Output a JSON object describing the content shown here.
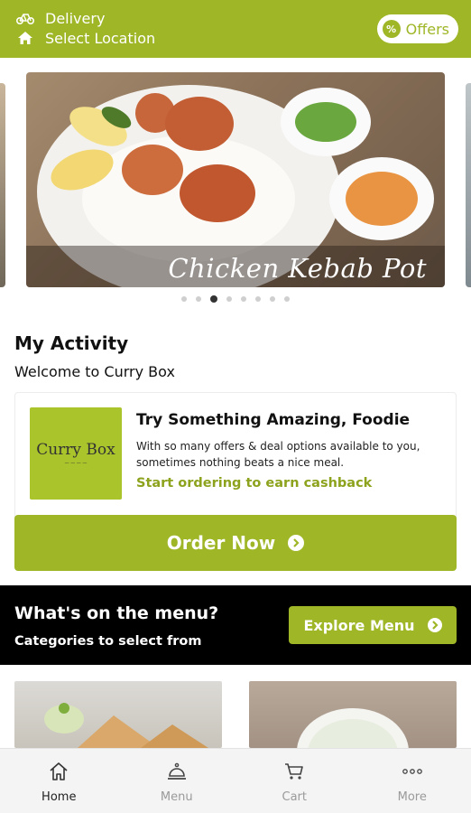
{
  "header": {
    "delivery_label": "Delivery",
    "location_label": "Select Location",
    "offers_label": "Offers"
  },
  "carousel": {
    "caption": "Chicken Kebab Pot",
    "slide_count": 8,
    "active_index": 2
  },
  "activity": {
    "title": "My Activity",
    "subtitle": "Welcome to Curry Box",
    "card": {
      "logo_text": "Curry Box",
      "title": "Try Something Amazing, Foodie",
      "body": "With so many offers & deal options available to you, sometimes nothing beats a nice meal.",
      "link": "Start ordering to earn cashback"
    },
    "order_button": "Order Now"
  },
  "menu_banner": {
    "title": "What's on the menu?",
    "subtitle": "Categories to select from",
    "explore_button": "Explore Menu"
  },
  "bottom_nav": {
    "items": [
      {
        "label": "Home",
        "icon": "home-icon",
        "active": true
      },
      {
        "label": "Menu",
        "icon": "cloche-icon",
        "active": false
      },
      {
        "label": "Cart",
        "icon": "cart-icon",
        "active": false
      },
      {
        "label": "More",
        "icon": "more-icon",
        "active": false
      }
    ]
  },
  "colors": {
    "brand_green": "#9fb627",
    "link_green": "#8da21d",
    "banner_black": "#000000"
  }
}
